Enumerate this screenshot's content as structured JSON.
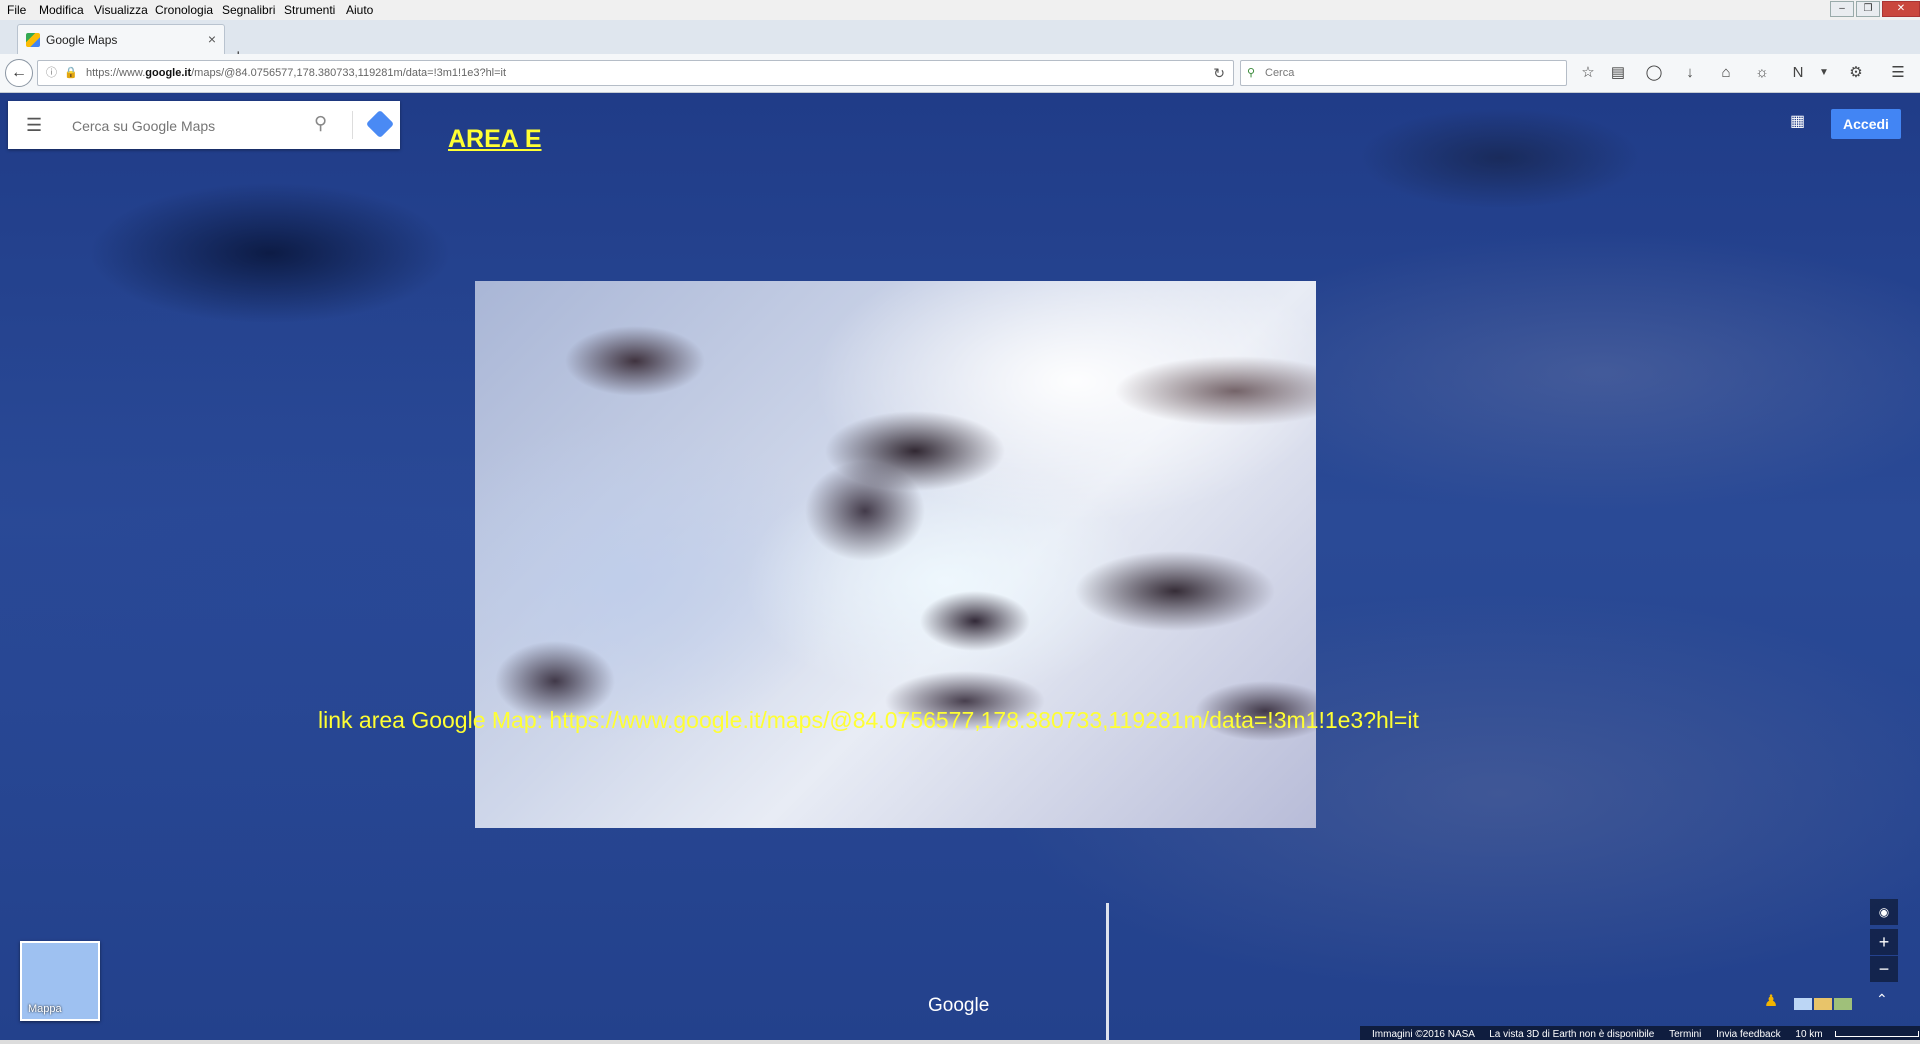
{
  "menu": [
    "File",
    "Modifica",
    "Visualizza",
    "Cronologia",
    "Segnalibri",
    "Strumenti",
    "Aiuto"
  ],
  "tab": {
    "title": "Google Maps"
  },
  "url": {
    "prefix": "https://www.",
    "domain": "google.it",
    "path": "/maps/@84.0756577,178.380733,119281m/data=!3m1!1e3?hl=it"
  },
  "search_bar": {
    "placeholder": "Cerca"
  },
  "maps": {
    "search_placeholder": "Cerca su Google Maps",
    "signin_label": "Accedi",
    "map_type_label": "Mappa",
    "logo": "Google"
  },
  "annotation": {
    "title": "AREA E",
    "link_text": "link area Google Map: https://www.google.it/maps/@84.0756577,178.380733,119281m/data=!3m1!1e3?hl=it"
  },
  "footer": {
    "imagery": "Immagini ©2016 NASA",
    "notice": "La vista 3D di Earth non è disponibile",
    "terms": "Termini",
    "feedback": "Invia feedback",
    "scale": "10 km"
  },
  "icons": {
    "back": "arrow-left-icon",
    "reload": "reload-icon",
    "bookmark": "star-icon",
    "menu": "hamburger-icon",
    "apps": "apps-grid-icon",
    "pegman": "pegman-icon"
  },
  "colors": {
    "annotation": "#ffff33",
    "signin": "#4285f4"
  }
}
